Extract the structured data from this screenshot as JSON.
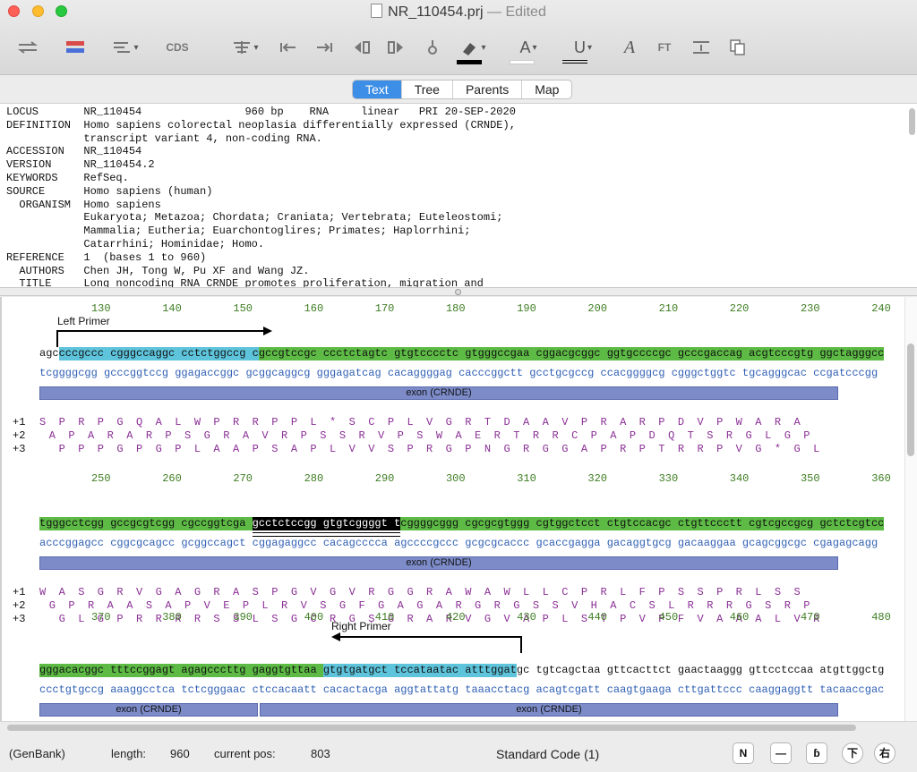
{
  "window": {
    "file_name": "NR_110454.prj",
    "edited_label": "— Edited"
  },
  "toolbar": {
    "cds_label": "CDS",
    "ft_label": "FT",
    "font_color_letter": "A",
    "underline_letter": "U",
    "italic_letter": "A",
    "swatch_colors": [
      "#000000",
      "#ffffff"
    ]
  },
  "view_tabs": [
    "Text",
    "Tree",
    "Parents",
    "Map"
  ],
  "active_tab": "Text",
  "genbank_text": "LOCUS       NR_110454                960 bp    RNA     linear   PRI 20-SEP-2020\nDEFINITION  Homo sapiens colorectal neoplasia differentially expressed (CRNDE),\n            transcript variant 4, non-coding RNA.\nACCESSION   NR_110454\nVERSION     NR_110454.2\nKEYWORDS    RefSeq.\nSOURCE      Homo sapiens (human)\n  ORGANISM  Homo sapiens\n            Eukaryota; Metazoa; Chordata; Craniata; Vertebrata; Euteleostomi;\n            Mammalia; Eutheria; Euarchontoglires; Primates; Haplorrhini;\n            Catarrhini; Hominidae; Homo.\nREFERENCE   1  (bases 1 to 960)\n  AUTHORS   Chen JH, Tong W, Pu XF and Wang JZ.\n  TITLE     Long noncoding RNA CRNDE promotes proliferation, migration and",
  "sequence_blocks": [
    {
      "positions": [
        "130",
        "140",
        "150",
        "160",
        "170",
        "180",
        "190",
        "200",
        "210",
        "220",
        "230",
        "240"
      ],
      "top_strand": "agccccgccc cgggccaggc cctctggccg cgccgtccgc ccctctagtc gtgtcccctc gtgggccgaa cggacgcggc ggtgccccgc gcccgaccag acgtcccgtg ggctagggcc",
      "bottom_strand": "tcggggcgg gcccggtccg ggagaccggc gcggcaggcg gggagatcag cacaggggag cacccggctt gcctgcgccg ccacggggcg cgggctggtc tgcagggcac ccgatcccgg",
      "features": [
        {
          "label": "exon (CRNDE)"
        }
      ],
      "frames": [
        {
          "label": "+1",
          "text": "S P R P G Q A L W P R R P P L * S C P L V G R T D A A V P R A R P D V P W A R A"
        },
        {
          "label": "+2",
          "text": " A P A R A R P S G R A V R P S S R V P S W A E R T R R C P A P D Q T S R G L G P"
        },
        {
          "label": "+3",
          "text": "  P P P G P G P L A A P S A P L V V S P R G P N G R G G A P R P T R R P V G * G L"
        }
      ]
    },
    {
      "positions": [
        "250",
        "260",
        "270",
        "280",
        "290",
        "300",
        "310",
        "320",
        "330",
        "340",
        "350",
        "360"
      ],
      "top_strand": "tgggcctcgg gccgcgtcgg cgccggtcga gcctctccgg gtgtcggggt tcggggcggg cgcgcgtggg cgtggctcct ctgtccacgc ctgttccctt cgtcgccgcg gctctcgtcc",
      "selected_text": "gcctctccgg gtgtcggggt t",
      "bottom_strand": "acccggagcc cggcgcagcc gcggccagct cggagaggcc cacagcccca agccccgccc gcgcgcaccc gcaccgagga gacaggtgcg gacaaggaa gcagcggcgc cgagagcagg",
      "features": [
        {
          "label": "exon (CRNDE)"
        }
      ],
      "frames": [
        {
          "label": "+1",
          "text": "W A S G R V G A G R A S P G V G V R G G R A W A W L L C P R L F P S S P R L S S"
        },
        {
          "label": "+2",
          "text": " G P R A A S A P V E P L R V S G F G A G A R G R G S S V H A C S L R R R G S R P"
        },
        {
          "label": "+3",
          "text": "  G L G P R R R R S S L S G C R G S G R A R V G V A P L S T P V P F V A A A L V R"
        }
      ]
    },
    {
      "positions": [
        "370",
        "380",
        "390",
        "400",
        "410",
        "420",
        "430",
        "440",
        "450",
        "460",
        "470",
        "480"
      ],
      "top_strand": "gggacacggc tttccggagt agagcccttg gaggtgttaa gtgtgatgct tccataatac atttggatgc tgtcagctaa gttcacttct gaactaaggg gttcctccaa atgttggctg",
      "bottom_strand": "ccctgtgccg aaaggcctca tctcgggaac ctccacaatt cacactacga aggtattatg taaacctacg acagtcgatt caagtgaaga cttgattccc caaggaggtt tacaaccgac",
      "features": [
        {
          "label": "exon (CRNDE)"
        },
        {
          "label": "exon (CRNDE)"
        }
      ]
    }
  ],
  "primers": {
    "left": "Left Primer",
    "right": "Right Primer"
  },
  "status_bar": {
    "format": "(GenBank)",
    "length_label": "length:",
    "length_value": "960",
    "pos_label": "current pos:",
    "pos_value": "803",
    "genetic_code": "Standard Code (1)",
    "buttons": [
      "N",
      "—",
      "ɓ",
      "下",
      "右"
    ]
  },
  "colors": {
    "feature_green": "#5dbb45",
    "primer_cyan": "#5ec4dc",
    "exon_blue": "#7d8cc9",
    "position_green": "#3e7d22",
    "complement_blue": "#2f5fb3",
    "translation_purple": "#8a2f95",
    "tab_active_blue": "#3d8ee6"
  }
}
